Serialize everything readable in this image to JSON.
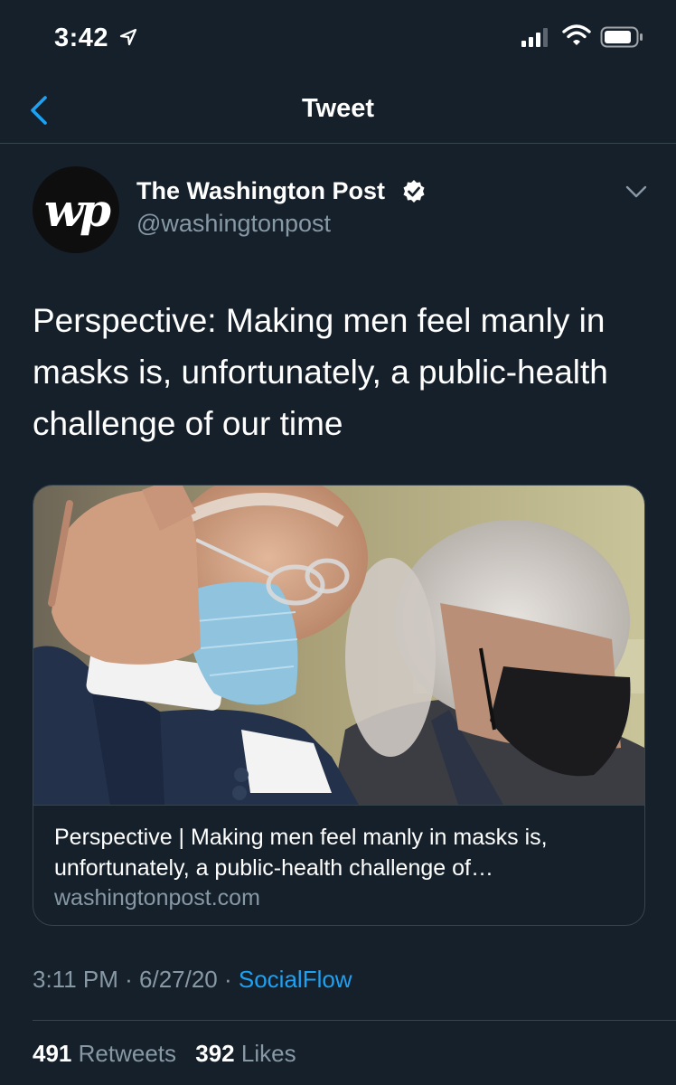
{
  "status_bar": {
    "time": "3:42"
  },
  "nav": {
    "title": "Tweet"
  },
  "author": {
    "name": "The Washington Post",
    "handle": "@washingtonpost",
    "avatar_text": "wp"
  },
  "tweet": {
    "text": "Perspective: Making men feel manly in masks is, unfortunately, a public-health challenge of our time"
  },
  "card": {
    "title": "Perspective | Making men feel manly in masks is, unfortunately, a public-health challenge of…",
    "domain": "washingtonpost.com"
  },
  "meta": {
    "time": "3:11 PM",
    "sep1": " · ",
    "date": "6/27/20",
    "sep2": " · ",
    "source": "SocialFlow"
  },
  "stats": {
    "retweets_count": "491",
    "retweets_label": "Retweets",
    "likes_count": "392",
    "likes_label": "Likes"
  },
  "colors": {
    "background": "#15202b",
    "accent": "#1da1f2",
    "secondary_text": "#8899a6",
    "border": "#38444d"
  }
}
